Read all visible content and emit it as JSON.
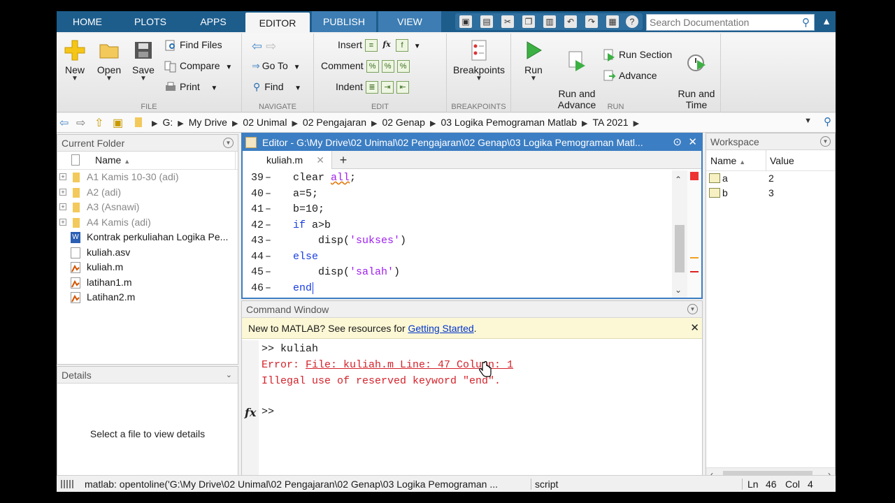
{
  "tabs": [
    "HOME",
    "PLOTS",
    "APPS",
    "EDITOR",
    "PUBLISH",
    "VIEW"
  ],
  "active_tab": "EDITOR",
  "search_doc": {
    "placeholder": "Search Documentation"
  },
  "ribbon": {
    "file": {
      "label": "FILE",
      "new": "New",
      "open": "Open",
      "save": "Save",
      "find_files": "Find Files",
      "compare": "Compare",
      "print": "Print"
    },
    "navigate": {
      "label": "NAVIGATE",
      "goto": "Go To",
      "find": "Find"
    },
    "edit": {
      "label": "EDIT",
      "insert": "Insert",
      "comment": "Comment",
      "indent": "Indent"
    },
    "breakpoints": {
      "label": "BREAKPOINTS",
      "button": "Breakpoints"
    },
    "run": {
      "label": "RUN",
      "run": "Run",
      "run_and_advance": "Run and\nAdvance",
      "run_section": "Run Section",
      "advance": "Advance",
      "run_and_time": "Run and\nTime"
    }
  },
  "breadcrumb": [
    "G:",
    "My Drive",
    "02 Unimal",
    "02 Pengajaran",
    "02 Genap",
    "03 Logika Pemograman Matlab",
    "TA 2021"
  ],
  "current_folder": {
    "title": "Current Folder",
    "column": "Name",
    "items": [
      {
        "name": "A1 Kamis 10-30 (adi)",
        "type": "folder"
      },
      {
        "name": "A2 (adi)",
        "type": "folder"
      },
      {
        "name": "A3 (Asnawi)",
        "type": "folder"
      },
      {
        "name": "A4 Kamis (adi)",
        "type": "folder"
      },
      {
        "name": "Kontrak perkuliahan Logika Pe...",
        "type": "word"
      },
      {
        "name": "kuliah.asv",
        "type": "file"
      },
      {
        "name": "kuliah.m",
        "type": "mfile"
      },
      {
        "name": "latihan1.m",
        "type": "mfile"
      },
      {
        "name": "Latihan2.m",
        "type": "mfile"
      }
    ]
  },
  "details": {
    "title": "Details",
    "message": "Select a file to view details"
  },
  "editor": {
    "title": "Editor - G:\\My Drive\\02 Unimal\\02 Pengajaran\\02 Genap\\03 Logika Pemograman Matl...",
    "tab": "kuliah.m",
    "lines": [
      {
        "n": "39",
        "indent": "",
        "parts": [
          [
            "plain",
            "clear "
          ],
          [
            "squig",
            "all"
          ],
          [
            "plain",
            ";"
          ]
        ]
      },
      {
        "n": "40",
        "indent": "",
        "parts": [
          [
            "plain",
            "a=5;"
          ]
        ]
      },
      {
        "n": "41",
        "indent": "",
        "parts": [
          [
            "plain",
            "b=10;"
          ]
        ]
      },
      {
        "n": "42",
        "indent": "",
        "parts": [
          [
            "kw",
            "if"
          ],
          [
            "plain",
            " a>b"
          ]
        ]
      },
      {
        "n": "43",
        "indent": "    ",
        "parts": [
          [
            "plain",
            "disp("
          ],
          [
            "str",
            "'sukses'"
          ],
          [
            "plain",
            ")"
          ]
        ]
      },
      {
        "n": "44",
        "indent": "",
        "parts": [
          [
            "kw",
            "else"
          ]
        ]
      },
      {
        "n": "45",
        "indent": "    ",
        "parts": [
          [
            "plain",
            "disp("
          ],
          [
            "str",
            "'salah'"
          ],
          [
            "plain",
            ")"
          ]
        ]
      },
      {
        "n": "46",
        "indent": "",
        "parts": [
          [
            "kw",
            "end"
          ]
        ]
      }
    ]
  },
  "command_window": {
    "title": "Command Window",
    "notice": "New to MATLAB? See resources for ",
    "notice_link": "Getting Started",
    "notice_end": ".",
    "prompt_line": ">> kuliah",
    "error_prefix": "Error: ",
    "error_link": "File: kuliah.m Line: 47 Column: 1",
    "error_message": "Illegal use of reserved keyword \"end\".",
    "prompt": ">>"
  },
  "workspace": {
    "title": "Workspace",
    "col_name": "Name",
    "col_value": "Value",
    "vars": [
      {
        "name": "a",
        "value": "2"
      },
      {
        "name": "b",
        "value": "3"
      }
    ]
  },
  "status": {
    "message": "matlab: opentoline('G:\\My Drive\\02 Unimal\\02 Pengajaran\\02 Genap\\03 Logika Pemograman ...",
    "type": "script",
    "ln_label": "Ln",
    "ln": "46",
    "col_label": "Col",
    "col": "4"
  },
  "colors": {
    "tab_bar": "#1d5d8c",
    "editor_border": "#3c7ec3",
    "keyword": "#1a3ee0",
    "string": "#a020f0",
    "error": "#d4222a"
  }
}
